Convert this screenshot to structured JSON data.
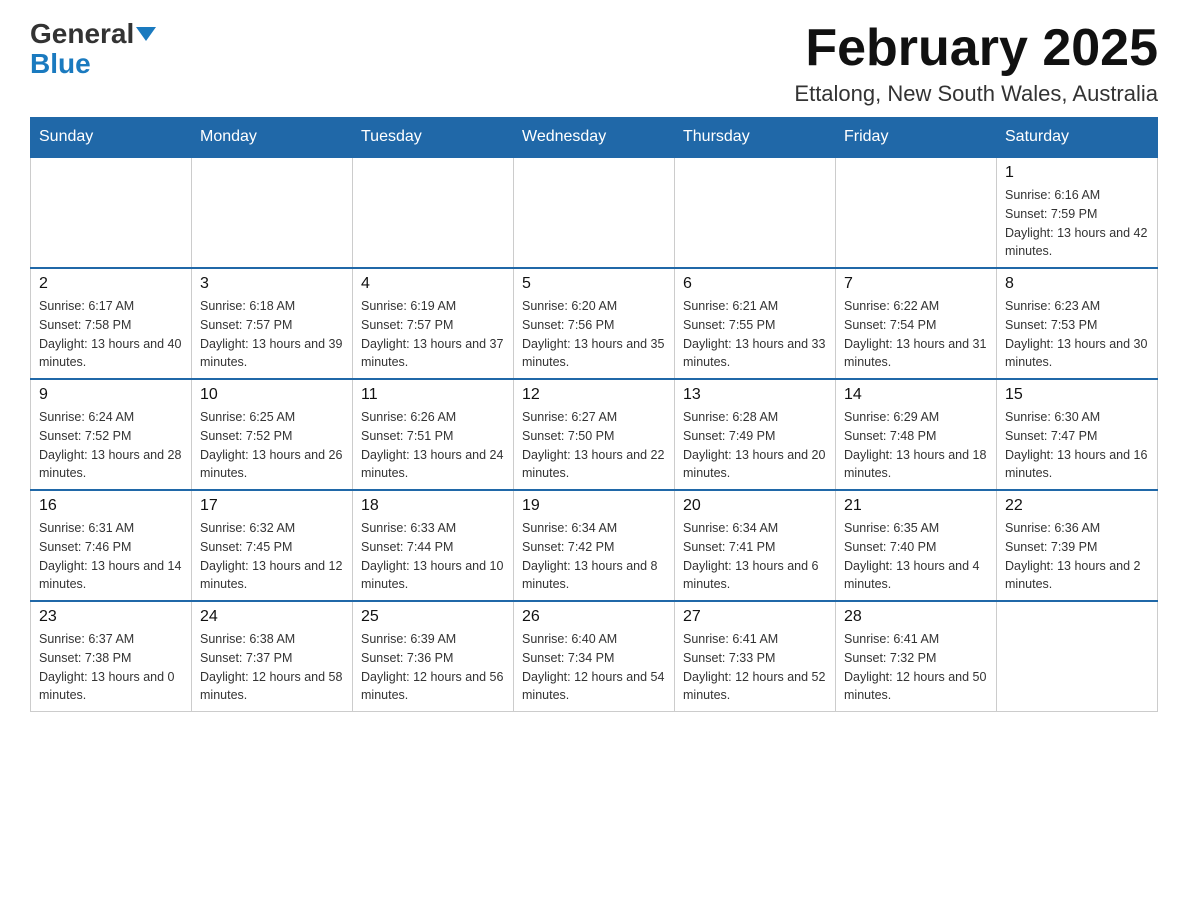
{
  "header": {
    "logo_general": "General",
    "logo_blue": "Blue",
    "month_title": "February 2025",
    "location": "Ettalong, New South Wales, Australia"
  },
  "days_of_week": [
    "Sunday",
    "Monday",
    "Tuesday",
    "Wednesday",
    "Thursday",
    "Friday",
    "Saturday"
  ],
  "weeks": [
    [
      {
        "day": "",
        "info": ""
      },
      {
        "day": "",
        "info": ""
      },
      {
        "day": "",
        "info": ""
      },
      {
        "day": "",
        "info": ""
      },
      {
        "day": "",
        "info": ""
      },
      {
        "day": "",
        "info": ""
      },
      {
        "day": "1",
        "info": "Sunrise: 6:16 AM\nSunset: 7:59 PM\nDaylight: 13 hours and 42 minutes."
      }
    ],
    [
      {
        "day": "2",
        "info": "Sunrise: 6:17 AM\nSunset: 7:58 PM\nDaylight: 13 hours and 40 minutes."
      },
      {
        "day": "3",
        "info": "Sunrise: 6:18 AM\nSunset: 7:57 PM\nDaylight: 13 hours and 39 minutes."
      },
      {
        "day": "4",
        "info": "Sunrise: 6:19 AM\nSunset: 7:57 PM\nDaylight: 13 hours and 37 minutes."
      },
      {
        "day": "5",
        "info": "Sunrise: 6:20 AM\nSunset: 7:56 PM\nDaylight: 13 hours and 35 minutes."
      },
      {
        "day": "6",
        "info": "Sunrise: 6:21 AM\nSunset: 7:55 PM\nDaylight: 13 hours and 33 minutes."
      },
      {
        "day": "7",
        "info": "Sunrise: 6:22 AM\nSunset: 7:54 PM\nDaylight: 13 hours and 31 minutes."
      },
      {
        "day": "8",
        "info": "Sunrise: 6:23 AM\nSunset: 7:53 PM\nDaylight: 13 hours and 30 minutes."
      }
    ],
    [
      {
        "day": "9",
        "info": "Sunrise: 6:24 AM\nSunset: 7:52 PM\nDaylight: 13 hours and 28 minutes."
      },
      {
        "day": "10",
        "info": "Sunrise: 6:25 AM\nSunset: 7:52 PM\nDaylight: 13 hours and 26 minutes."
      },
      {
        "day": "11",
        "info": "Sunrise: 6:26 AM\nSunset: 7:51 PM\nDaylight: 13 hours and 24 minutes."
      },
      {
        "day": "12",
        "info": "Sunrise: 6:27 AM\nSunset: 7:50 PM\nDaylight: 13 hours and 22 minutes."
      },
      {
        "day": "13",
        "info": "Sunrise: 6:28 AM\nSunset: 7:49 PM\nDaylight: 13 hours and 20 minutes."
      },
      {
        "day": "14",
        "info": "Sunrise: 6:29 AM\nSunset: 7:48 PM\nDaylight: 13 hours and 18 minutes."
      },
      {
        "day": "15",
        "info": "Sunrise: 6:30 AM\nSunset: 7:47 PM\nDaylight: 13 hours and 16 minutes."
      }
    ],
    [
      {
        "day": "16",
        "info": "Sunrise: 6:31 AM\nSunset: 7:46 PM\nDaylight: 13 hours and 14 minutes."
      },
      {
        "day": "17",
        "info": "Sunrise: 6:32 AM\nSunset: 7:45 PM\nDaylight: 13 hours and 12 minutes."
      },
      {
        "day": "18",
        "info": "Sunrise: 6:33 AM\nSunset: 7:44 PM\nDaylight: 13 hours and 10 minutes."
      },
      {
        "day": "19",
        "info": "Sunrise: 6:34 AM\nSunset: 7:42 PM\nDaylight: 13 hours and 8 minutes."
      },
      {
        "day": "20",
        "info": "Sunrise: 6:34 AM\nSunset: 7:41 PM\nDaylight: 13 hours and 6 minutes."
      },
      {
        "day": "21",
        "info": "Sunrise: 6:35 AM\nSunset: 7:40 PM\nDaylight: 13 hours and 4 minutes."
      },
      {
        "day": "22",
        "info": "Sunrise: 6:36 AM\nSunset: 7:39 PM\nDaylight: 13 hours and 2 minutes."
      }
    ],
    [
      {
        "day": "23",
        "info": "Sunrise: 6:37 AM\nSunset: 7:38 PM\nDaylight: 13 hours and 0 minutes."
      },
      {
        "day": "24",
        "info": "Sunrise: 6:38 AM\nSunset: 7:37 PM\nDaylight: 12 hours and 58 minutes."
      },
      {
        "day": "25",
        "info": "Sunrise: 6:39 AM\nSunset: 7:36 PM\nDaylight: 12 hours and 56 minutes."
      },
      {
        "day": "26",
        "info": "Sunrise: 6:40 AM\nSunset: 7:34 PM\nDaylight: 12 hours and 54 minutes."
      },
      {
        "day": "27",
        "info": "Sunrise: 6:41 AM\nSunset: 7:33 PM\nDaylight: 12 hours and 52 minutes."
      },
      {
        "day": "28",
        "info": "Sunrise: 6:41 AM\nSunset: 7:32 PM\nDaylight: 12 hours and 50 minutes."
      },
      {
        "day": "",
        "info": ""
      }
    ]
  ]
}
